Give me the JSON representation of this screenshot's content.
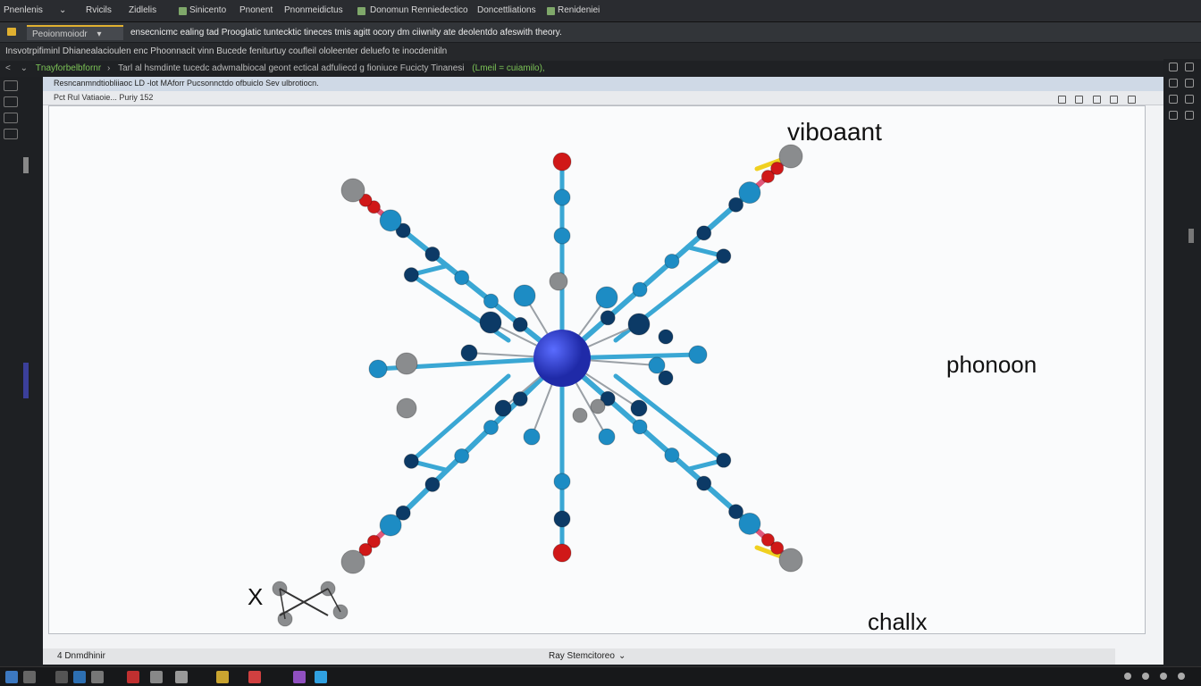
{
  "menubar": {
    "items": [
      "Pnenlenis",
      "Rvicils",
      "Zidlelis",
      "Sinicento",
      "Pnonent",
      "Pnonmeidictus",
      "Donomun Renniedectico",
      "Doncettliations",
      "Renideniei"
    ]
  },
  "tabs": {
    "active_label": "Peoionmoiodr",
    "info_text": "ensecnicmc ealing tad Prooglatic tuntecktic tineces tmis agitt ocory dm ciiwnity ate deolentdo afeswith theory."
  },
  "pathbar": {
    "text": "Insvotrpifiminl Dhianealacioulen enc Phoonnacit vinn Bucede feniturtuy coufleil ololeenter deluefo te inocdenitiln"
  },
  "subbar": {
    "link": "Tnayforbelbfornr",
    "text": "Tarl al hsmdinte tucedc adwmalbiocal geont ectical adfuliecd g fioniuce Fucicty Tinanesi",
    "tag": "(Lmeil = cuiamilo),"
  },
  "document": {
    "title": "Resncanmndtiobliiaoc LD -lot MAforr Pucsonnctdo ofbuiclo Sev ulbrotiocn.",
    "subtitle": "Pct Rul Vatiaoie... Puriy 152",
    "status_left": "4 Dnmdhinir",
    "status_center": "Ray Stemcitoreo"
  },
  "figure": {
    "labels": {
      "top_right": "viboaant",
      "middle_right": "phonoon",
      "bottom_right": "challx",
      "bottom_left": "X"
    }
  },
  "colors": {
    "bond_cyan": "#3aa7d4",
    "atom_navy": "#0c3a66",
    "atom_blue": "#1d8cc4",
    "center_atom": "#1f2aa8",
    "oxygen_red": "#d01818",
    "pink_bond": "#e0587a",
    "yellow_bond": "#f0d020",
    "grey_atom": "#8a8c8e"
  }
}
